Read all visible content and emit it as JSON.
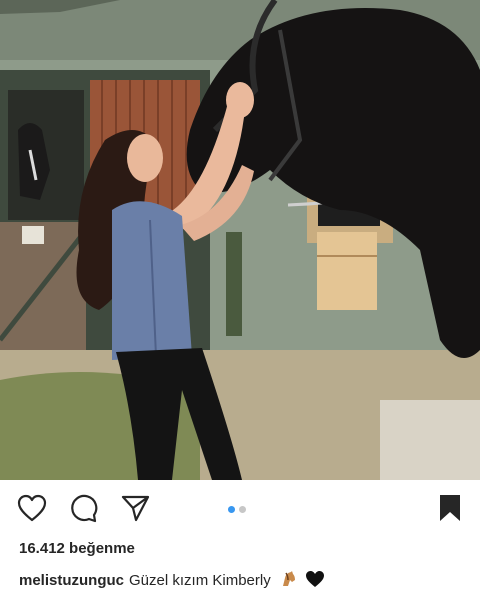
{
  "post": {
    "likes_text": "16.412 beğenme",
    "username": "melistuzunguc",
    "caption_text": "Güzel kızım Kimberly",
    "caption_emojis": [
      "horse-face-emoji",
      "black-heart-emoji"
    ]
  },
  "carousel": {
    "total": 2,
    "active_index": 0
  },
  "icons": {
    "like": "heart-outline-icon",
    "comment": "comment-bubble-icon",
    "share": "paper-plane-icon",
    "save": "bookmark-filled-icon"
  },
  "colors": {
    "text": "#262626",
    "active_dot": "#3897f0",
    "inactive_dot": "#c7c7c7",
    "background": "#ffffff"
  }
}
